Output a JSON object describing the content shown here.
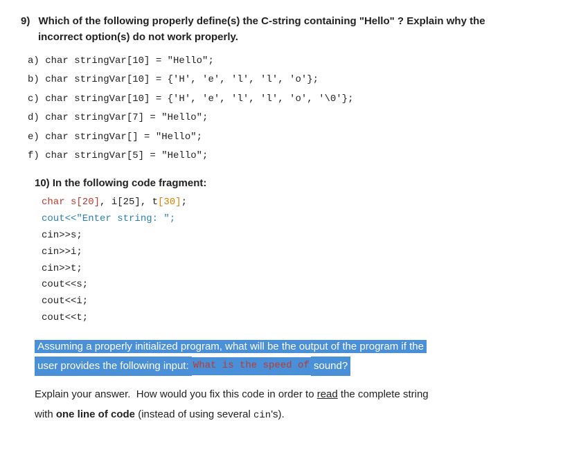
{
  "question9": {
    "number": "9)",
    "title_part1": "Which of the following properly define(s) the C-string containing \"Hello\" ? Explain why the",
    "title_part2": "incorrect option(s) do not work properly.",
    "options": [
      "a) char stringVar[10] = \"Hello\";",
      "b) char stringVar[10] = {'H', 'e', 'l', 'l', 'o'};",
      "c) char stringVar[10] = {'H', 'e', 'l', 'l', 'o', '\\0'};",
      "d) char stringVar[7] = \"Hello\";",
      "e) char stringVar[] = \"Hello\";",
      "f) char stringVar[5] = \"Hello\";"
    ]
  },
  "question10": {
    "number": "10)",
    "title": "In the following code fragment:",
    "code_lines": [
      {
        "text": "char s[20], i[25], t[30];",
        "parts": [
          {
            "text": "char ",
            "style": "normal"
          },
          {
            "text": "s[20]",
            "style": "red"
          },
          {
            "text": ", ",
            "style": "normal"
          },
          {
            "text": "i[25]",
            "style": "normal"
          },
          {
            "text": ", t",
            "style": "normal"
          },
          {
            "text": "[30]",
            "style": "orange"
          },
          {
            "text": ";",
            "style": "normal"
          }
        ]
      },
      {
        "text": "cout<<\"Enter string: \";",
        "style": "blue"
      },
      {
        "text": "cin>>s;",
        "style": "normal"
      },
      {
        "text": "cin>>i;",
        "style": "normal"
      },
      {
        "text": "cin>>t;",
        "style": "normal"
      },
      {
        "text": "cout<<s;",
        "style": "normal"
      },
      {
        "text": "cout<<i;",
        "style": "normal"
      },
      {
        "text": "cout<<t;",
        "style": "normal"
      }
    ],
    "highlighted_text1": "Assuming a properly initialized program, what will be the output of the program if the",
    "highlighted_text2_part1": "user provides the following input:",
    "highlighted_text2_code": "What is the speed of",
    "highlighted_text2_end": "sound?",
    "answer_line1": "Explain your answer.  How would you fix this code in order to",
    "answer_underline": "read",
    "answer_line1_end": "the complete string",
    "answer_line2_start": "with ",
    "answer_line2_bold": "one line of code",
    "answer_line2_end": " (instead of using several ",
    "answer_line2_code": "cin",
    "answer_line2_final": "'s)."
  }
}
